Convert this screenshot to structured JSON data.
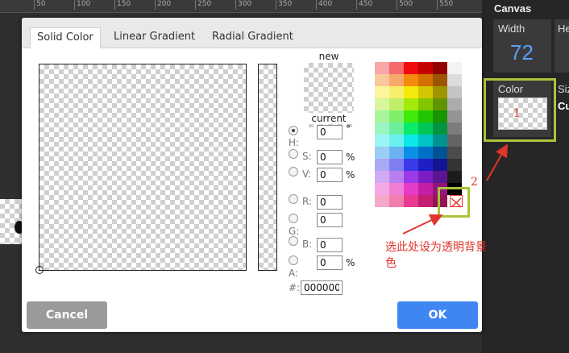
{
  "ruler": {
    "ticks": [
      "50",
      "100",
      "150",
      "200",
      "250",
      "300",
      "350",
      "400",
      "450",
      "500",
      "550"
    ]
  },
  "right_panel": {
    "title": "Canvas",
    "width_label": "Width",
    "width_value": "72",
    "height_label_partial": "He",
    "color_label": "Color",
    "size_label_partial": "Siz",
    "size_value_partial": "Cu"
  },
  "dialog": {
    "tabs": [
      {
        "label": "Solid Color",
        "active": true
      },
      {
        "label": "Linear Gradient",
        "active": false
      },
      {
        "label": "Radial Gradient",
        "active": false
      }
    ],
    "preview": {
      "new_label": "new",
      "current_label": "current"
    },
    "fields": {
      "h": {
        "label": "H:",
        "value": "0",
        "unit": "°"
      },
      "s": {
        "label": "S:",
        "value": "0",
        "unit": "%"
      },
      "v": {
        "label": "V:",
        "value": "0",
        "unit": "%"
      },
      "r": {
        "label": "R:",
        "value": "0"
      },
      "g": {
        "label": "G:",
        "value": "0"
      },
      "b": {
        "label": "B:",
        "value": "0"
      },
      "a": {
        "label": "A:",
        "value": "0",
        "unit": "%"
      },
      "hex": {
        "label": "#:",
        "value": "000000"
      }
    },
    "palette_columns": [
      [
        "#f7a7a7",
        "#f9c99b",
        "#fbf59b",
        "#d8f59b",
        "#a9f59b",
        "#9bf5c2",
        "#9bf5f5",
        "#9bcdf5",
        "#a9a9f5",
        "#d2a9f5",
        "#f5a9e4",
        "#f5a9c8"
      ],
      [
        "#f56b6b",
        "#f7a96b",
        "#f7ef6b",
        "#c1ef6b",
        "#7fef6b",
        "#6bef9f",
        "#6bf0f0",
        "#6bb3f0",
        "#7e7ef0",
        "#b97ef0",
        "#f07ed6",
        "#f07eaf"
      ],
      [
        "#f00c0c",
        "#f58a0c",
        "#f5ea0c",
        "#a3ea0c",
        "#3fea0c",
        "#0cea6a",
        "#0ce8e8",
        "#0c8fe8",
        "#3a3ae8",
        "#9a3ae8",
        "#e83ac8",
        "#e83a92"
      ],
      [
        "#c50000",
        "#d27000",
        "#d2c600",
        "#82c600",
        "#22c600",
        "#00c655",
        "#00c4c4",
        "#0070c4",
        "#1e1ec4",
        "#7a1ec4",
        "#c41ea6",
        "#c41e73"
      ],
      [
        "#920000",
        "#9e5400",
        "#9e9500",
        "#619500",
        "#179500",
        "#00953f",
        "#009393",
        "#005393",
        "#151593",
        "#5b1593",
        "#93157c",
        "#931556"
      ],
      [
        "#f4f4f4",
        "#dcdcdc",
        "#c4c4c4",
        "#acacac",
        "#949494",
        "#7c7c7c",
        "#646464",
        "#4c4c4c",
        "#343434",
        "#1c1c1c",
        "#000000",
        ""
      ]
    ],
    "buttons": {
      "cancel": "Cancel",
      "ok": "OK"
    }
  },
  "annotations": {
    "marker_1": "1",
    "marker_2": "2",
    "note": "选此处设为透明背景色",
    "color": "#e0352b",
    "box_color": "#a8c43a"
  }
}
